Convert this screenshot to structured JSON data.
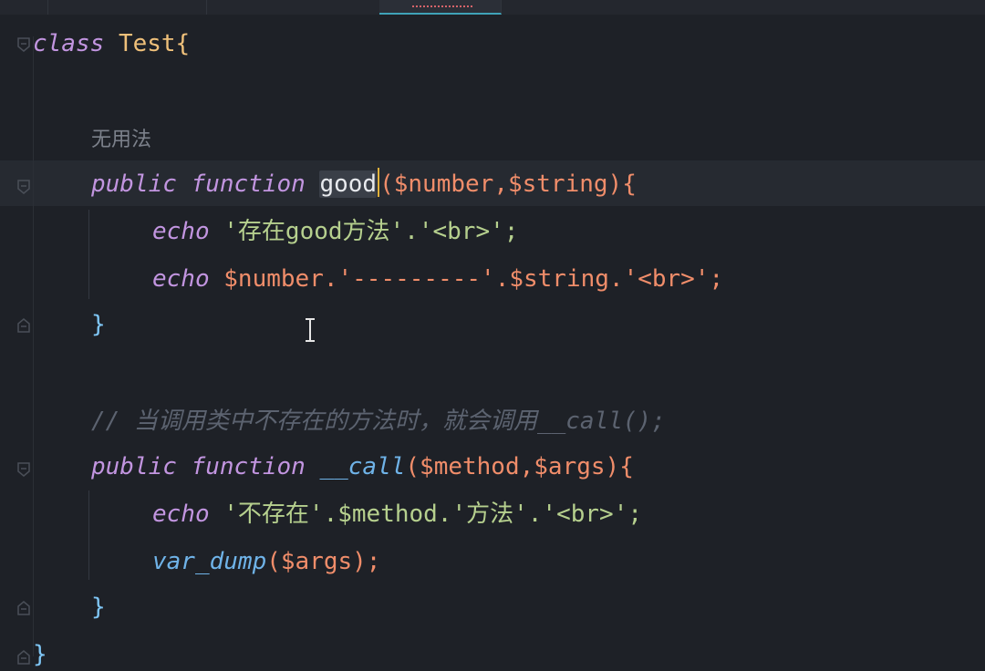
{
  "editor": {
    "lines": {
      "class_kw": "class",
      "class_name": "Test{",
      "hint_label": "无用法",
      "l1_public": "public",
      "l1_function": "function",
      "l1_name": "good",
      "l1_params": "($number,$string){",
      "l2_echo": "echo",
      "l2_rest": " '存在good方法'.'<br>';",
      "l3_echo": "echo",
      "l3_rest": " $number.'---------'.$string.'<br>';",
      "close1": "}",
      "comment": "// 当调用类中不存在的方法时，就会调用__call();",
      "l4_public": "public",
      "l4_function": "function",
      "l4_name": "__call",
      "l4_params": "($method,$args){",
      "l5_echo": "echo",
      "l5_rest": " '不存在'.$method.'方法'.'<br>';",
      "l6_fn": "var_dump",
      "l6_rest": "($args);",
      "close2": "}",
      "close_class": "}"
    }
  },
  "colors": {
    "background": "#1e2127",
    "keyword": "#c295e0",
    "variable": "#f08d6a",
    "string": "#b6d08e",
    "class_name": "#efc07a",
    "caret": "#e0b13c"
  },
  "icons": [
    "fold-open-icon",
    "fold-close-icon",
    "text-cursor-icon"
  ]
}
